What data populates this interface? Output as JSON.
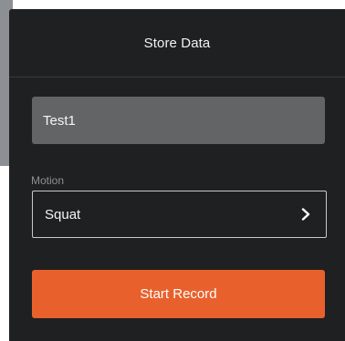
{
  "dialog": {
    "title": "Store Data"
  },
  "name_field": {
    "value": "Test1"
  },
  "motion": {
    "label": "Motion",
    "selected": "Squat",
    "icon": "chevron-right-icon"
  },
  "record_button": {
    "label": "Start Record"
  },
  "colors": {
    "panel_background": "#1f2021",
    "field_background": "#636466",
    "accent": "#e8612c",
    "text": "#f5f5f5",
    "muted_label": "#8e8f91"
  }
}
